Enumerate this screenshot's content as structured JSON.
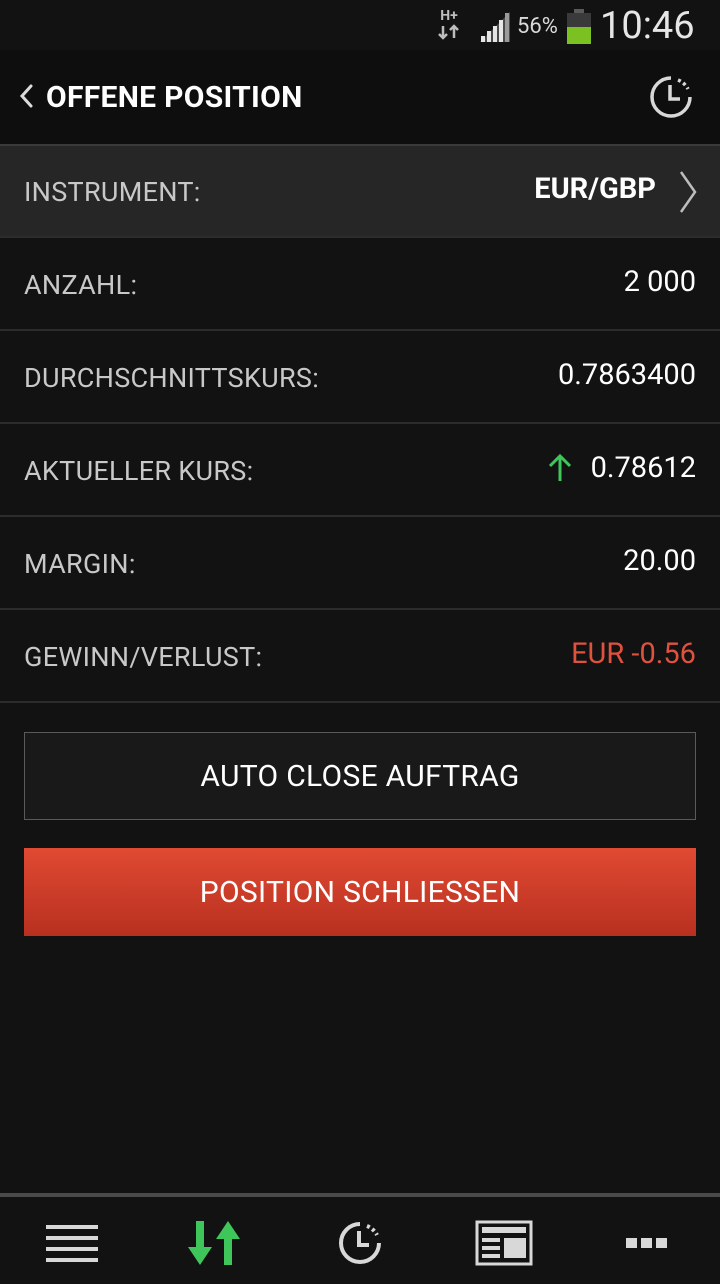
{
  "status": {
    "network": "H+",
    "battery": "56%",
    "time": "10:46"
  },
  "header": {
    "title": "OFFENE POSITION"
  },
  "rows": [
    {
      "label": "INSTRUMENT:",
      "value": "EUR/GBP"
    },
    {
      "label": "ANZAHL:",
      "value": "2 000"
    },
    {
      "label": "DURCHSCHNITTSKURS:",
      "value": "0.7863400"
    },
    {
      "label": "AKTUELLER KURS:",
      "value": "0.78612"
    },
    {
      "label": "MARGIN:",
      "value": "20.00"
    },
    {
      "label": "GEWINN/VERLUST:",
      "value": "EUR -0.56"
    }
  ],
  "buttons": {
    "auto_close": "AUTO CLOSE AUFTRAG",
    "close_position": "POSITION SCHLIESSEN"
  },
  "nav": [
    "menu-icon",
    "trade-arrows-icon",
    "history-clock-icon",
    "news-icon",
    "more-icon"
  ],
  "colors": {
    "accent_red": "#e0513e",
    "up_green": "#3ec65a"
  }
}
